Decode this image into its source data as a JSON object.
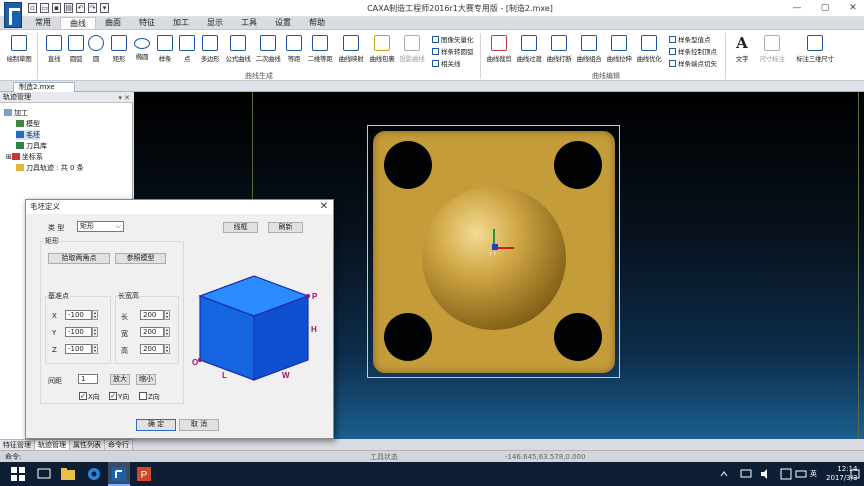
{
  "window": {
    "title": "CAXA制造工程师2016r1大赛专用版 - [制造2.mxe]",
    "controls": [
      "—",
      "▢",
      "✕"
    ]
  },
  "menu": [
    "常用",
    "曲线",
    "曲面",
    "特征",
    "加工",
    "显示",
    "工具",
    "设置",
    "帮助"
  ],
  "ribbon": {
    "sketch": "绘制草图",
    "curve_tools": [
      "直线",
      "圆弧",
      "圆",
      "矩形",
      "椭圆",
      "样条",
      "点",
      "多边形",
      "公式曲线",
      "二次曲线",
      "等距",
      "二维等距",
      "曲线映射",
      "曲线包裹",
      "投影曲线"
    ],
    "curve_small": [
      "图像矢量化",
      "样条转圆弧",
      "相关线"
    ],
    "edit_tools": [
      "曲线裁剪",
      "曲线过渡",
      "曲线打断",
      "曲线组合",
      "曲线拉伸",
      "曲线优化"
    ],
    "edit_small": [
      "样条型值点",
      "样条控制顶点",
      "样条端点切矢"
    ],
    "text_tool": "文字",
    "dim_tools": [
      "尺寸标注",
      "标注三维尺寸"
    ],
    "group_curve_gen": "曲线生成",
    "group_curve_edit": "曲线编辑"
  },
  "doc_tab": "制造2.mxe",
  "panel": {
    "title": "轨迹管理",
    "pins": "▾ ✕",
    "tree": [
      "加工",
      "模型",
      "毛坯",
      "刀具库",
      "坐标系",
      "刀具轨迹 : 共 0 条"
    ]
  },
  "bottom_tabs": [
    "特征管理",
    "轨迹管理",
    "属性列表",
    "命令行"
  ],
  "status": {
    "cmd": "命令:",
    "state": "工具状态",
    "coords": "-146.645,63.578,0.000"
  },
  "taskbar": {
    "lang": "英",
    "time": "12:14",
    "date": "2017/3/3"
  },
  "axis_label": "y x",
  "dialog": {
    "title": "毛坯定义",
    "close": "✕",
    "type_label": "类 型",
    "type_value": "矩形",
    "btn_frame": "线框",
    "btn_refresh": "刷新",
    "group_rect": "矩形",
    "btn_pick": "拾取两角点",
    "btn_ref": "参照模型",
    "base_title": "基准点",
    "size_title": "长宽高",
    "x_label": "X",
    "x_value": "-100",
    "y_label": "Y",
    "y_value": "-100",
    "z_label": "Z",
    "z_value": "-100",
    "l_label": "长",
    "l_value": "200",
    "w_label": "宽",
    "w_value": "200",
    "h_label": "高",
    "h_value": "200",
    "step_label": "间距",
    "step_value": "1",
    "btn_zoomin": "放大",
    "btn_zoomout": "缩小",
    "chk_x": "X向",
    "chk_y": "Y向",
    "chk_z": "Z向",
    "chk_x_mark": "✓",
    "chk_y_mark": "✓",
    "chk_z_mark": "",
    "cube_labels": [
      "P",
      "H",
      "O",
      "L",
      "W"
    ],
    "ok": "确 定",
    "cancel": "取 消"
  },
  "colors": {
    "accent": "#1e58a5",
    "plate": "#c59c3a",
    "cube": "#1565e0",
    "cube_edge": "#1a2fb0",
    "cube_label": "#a0106a"
  }
}
